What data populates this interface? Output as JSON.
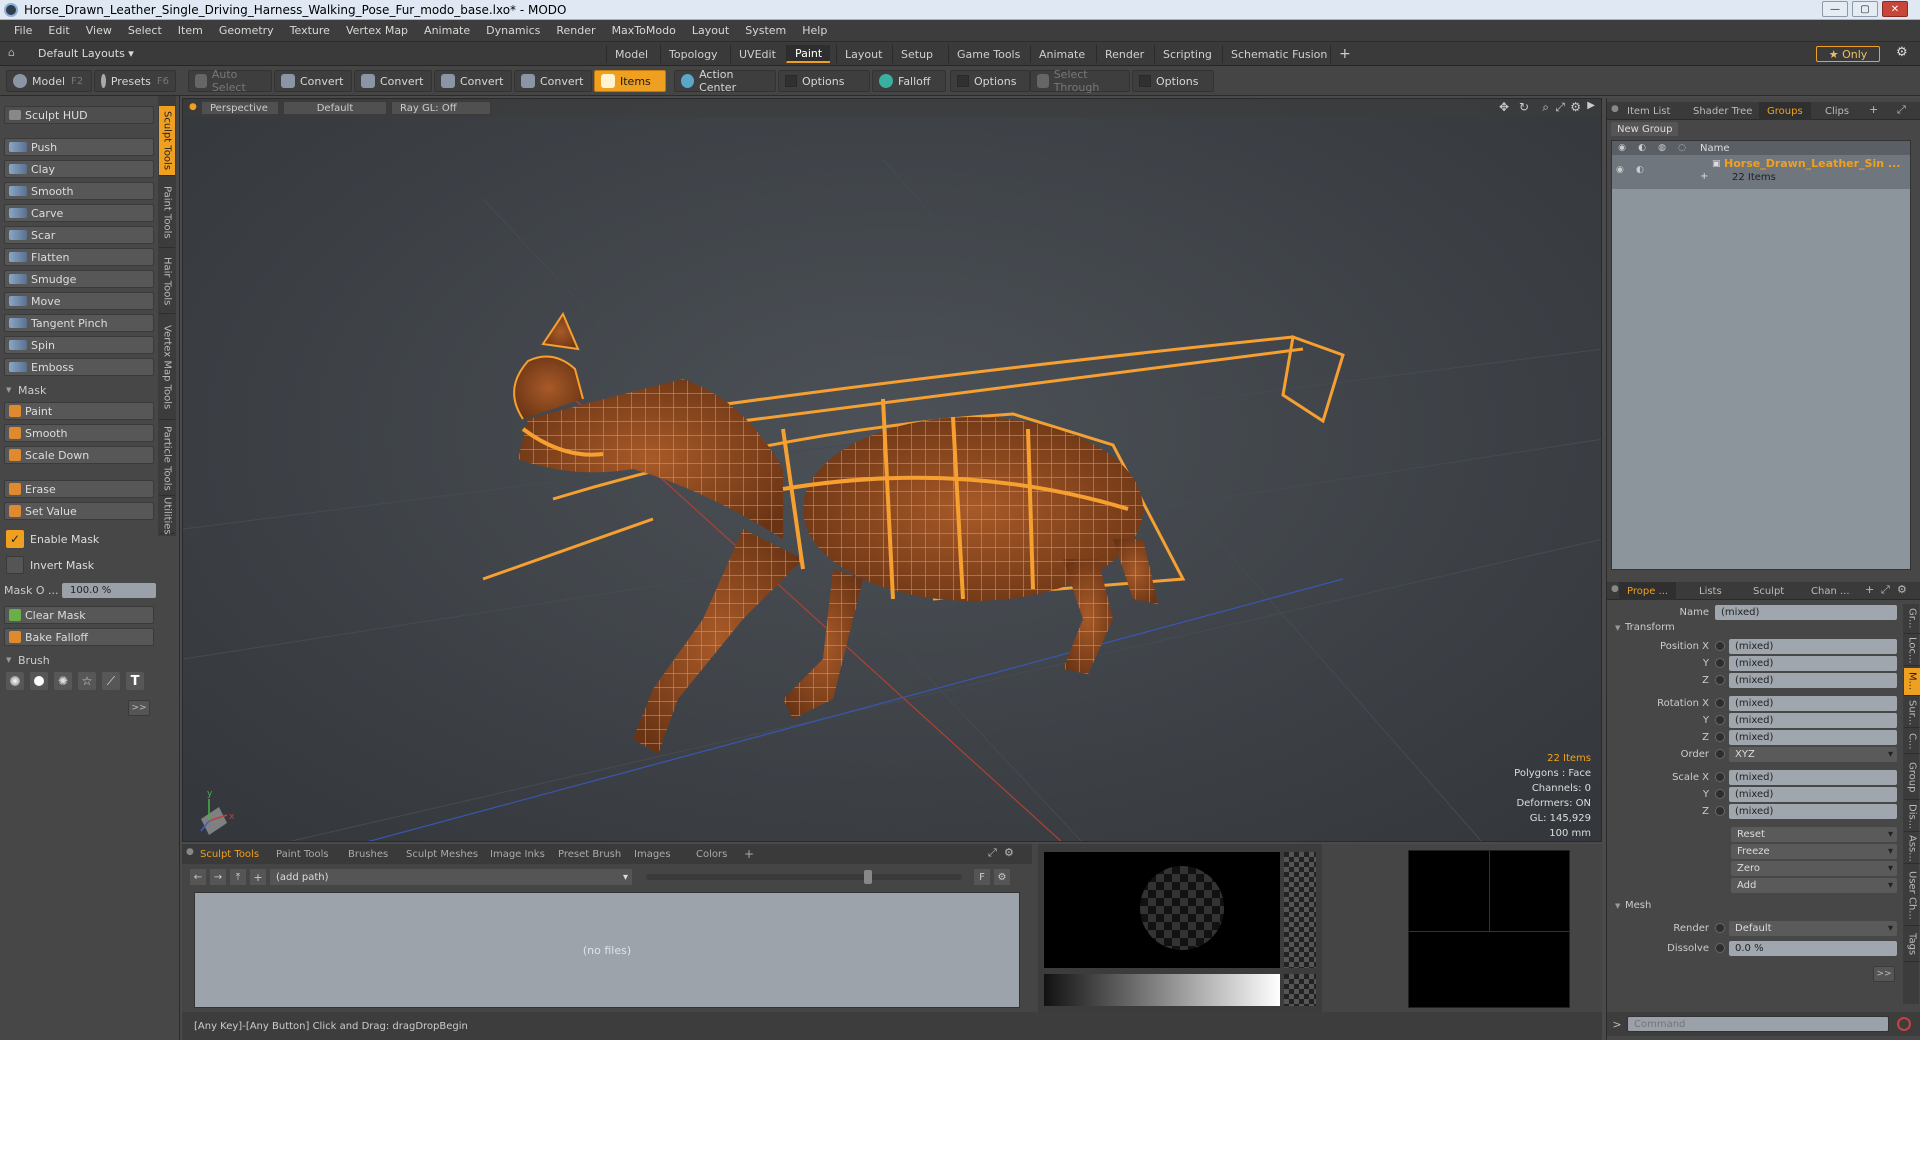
{
  "window": {
    "title": "Horse_Drawn_Leather_Single_Driving_Harness_Walking_Pose_Fur_modo_base.lxo* - MODO",
    "min": "—",
    "max": "▢",
    "close": "✕"
  },
  "menu": [
    "File",
    "Edit",
    "View",
    "Select",
    "Item",
    "Geometry",
    "Texture",
    "Vertex Map",
    "Animate",
    "Dynamics",
    "Render",
    "MaxToModo",
    "Layout",
    "System",
    "Help"
  ],
  "layoutbar": {
    "layouts_label": "Default Layouts ▾",
    "tabs": [
      "Model",
      "Topology",
      "UVEdit",
      "Paint",
      "Layout",
      "Setup",
      "Game Tools",
      "Animate",
      "Render",
      "Scripting",
      "Schematic Fusion"
    ],
    "active_tab": "Paint",
    "add": "+",
    "only_label": "★ Only",
    "gear": "⚙"
  },
  "toolbar": {
    "model": "Model",
    "model_key": "F2",
    "presets": "Presets",
    "presets_key": "F6",
    "auto_select": "Auto Select",
    "convert": "Convert",
    "items": "Items",
    "action_center": "Action Center",
    "options": "Options",
    "falloff": "Falloff",
    "select_through": "Select Through"
  },
  "left": {
    "hud": "Sculpt HUD",
    "tools": [
      "Push",
      "Clay",
      "Smooth",
      "Carve",
      "Scar",
      "Flatten",
      "Smudge",
      "Move",
      "Tangent Pinch",
      "Spin",
      "Emboss"
    ],
    "mask_header": "Mask",
    "mask_tools": [
      "Paint",
      "Smooth",
      "Scale Down"
    ],
    "erase": "Erase",
    "set_value": "Set Value",
    "enable_mask": "Enable Mask",
    "invert_mask": "Invert Mask",
    "mask_opacity_label": "Mask O ...",
    "mask_opacity_value": "100.0 %",
    "clear_mask": "Clear Mask",
    "bake_falloff": "Bake Falloff",
    "brush_header": "Brush",
    "more": ">>",
    "side_tabs": [
      "Sculpt Tools",
      "Paint Tools",
      "Hair Tools",
      "Vertex Map Tools",
      "Particle Tools",
      "Utilities"
    ]
  },
  "viewport": {
    "view": "Perspective",
    "shading": "Default",
    "raygl": "Ray GL: Off",
    "info": {
      "items": "22 Items",
      "polygons": "Polygons : Face",
      "channels": "Channels: 0",
      "deformers": "Deformers: ON",
      "gl": "GL: 145,929",
      "scale": "100 mm"
    }
  },
  "groups_panel": {
    "tabs": [
      "Item List",
      "Shader Tree",
      "Groups",
      "Clips"
    ],
    "active": "Groups",
    "new_group": "New Group",
    "col_name": "Name",
    "group_name": "Horse_Drawn_Leather_Sin ...",
    "group_count": "22 Items"
  },
  "properties": {
    "tabs": [
      "Prope ...",
      "Lists",
      "Sculpt",
      "Chan ..."
    ],
    "name_label": "Name",
    "name_value": "(mixed)",
    "transform_header": "Transform",
    "position_x": "Position X",
    "rotation_x": "Rotation X",
    "scale_x": "Scale X",
    "y": "Y",
    "z": "Z",
    "mixed": "(mixed)",
    "order_label": "Order",
    "order_value": "XYZ",
    "reset": "Reset",
    "freeze": "Freeze",
    "zero": "Zero",
    "add": "Add",
    "mesh_header": "Mesh",
    "render_label": "Render",
    "render_value": "Default",
    "dissolve_label": "Dissolve",
    "dissolve_value": "0.0 %",
    "more": ">>",
    "command_prompt": ">",
    "command_placeholder": "Command",
    "side_tabs": [
      "Gr...",
      "Loc...",
      "M...",
      "Sur...",
      "C...",
      "Group",
      "Dis...",
      "Ass...",
      "User Ch...",
      "Tags"
    ]
  },
  "bottom": {
    "tabs": [
      "Sculpt Tools",
      "Paint Tools",
      "Brushes",
      "Sculpt Meshes",
      "Image Inks",
      "Preset Brush",
      "Images",
      "Colors"
    ],
    "active": "Sculpt Tools",
    "add": "+",
    "path": "(add path)",
    "no_files": "(no files)",
    "f_btn": "F"
  },
  "status": "[Any Key]-[Any Button] Click and Drag:  dragDropBegin",
  "colors": {
    "accent": "#f0a020",
    "mesh": "#e8902a"
  }
}
